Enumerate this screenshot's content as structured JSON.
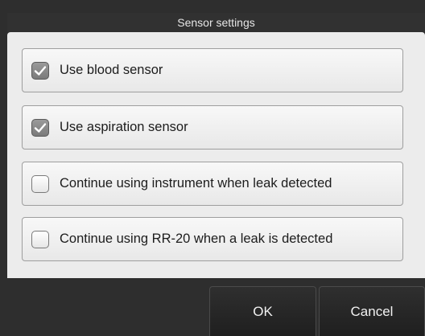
{
  "dialog": {
    "title": "Sensor settings",
    "options": [
      {
        "label": "Use blood sensor",
        "checked": true
      },
      {
        "label": "Use aspiration sensor",
        "checked": true
      },
      {
        "label": "Continue using instrument when leak detected",
        "checked": false
      },
      {
        "label": "Continue using RR-20 when a leak is detected",
        "checked": false
      }
    ],
    "buttons": {
      "ok_label": "OK",
      "cancel_label": "Cancel"
    }
  },
  "colors": {
    "frame": "#2e2e2e",
    "panel": "#ececec",
    "row_border": "#9e9e9e",
    "checked_fill": "#8a8a8a"
  },
  "icons": [
    "check-icon"
  ]
}
